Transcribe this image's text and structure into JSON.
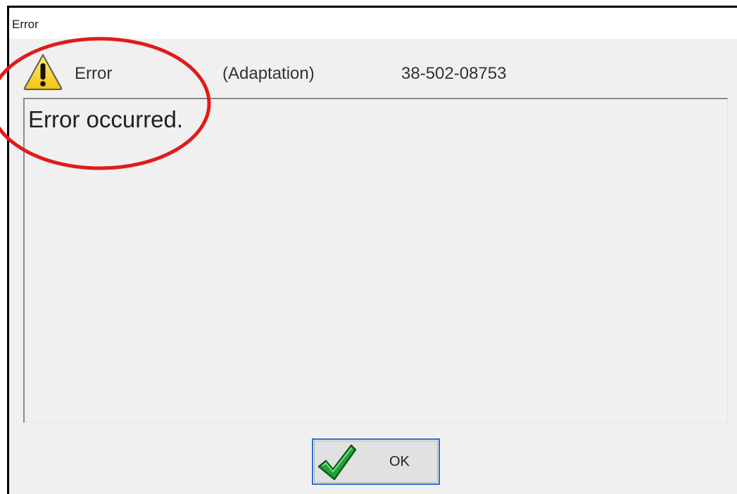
{
  "window": {
    "title": "Error"
  },
  "header": {
    "type": "Error",
    "category": "(Adaptation)",
    "code": "38-502-08753",
    "icon": "warning-icon"
  },
  "message": {
    "text": "Error occurred."
  },
  "buttons": {
    "ok": {
      "label": "OK",
      "icon": "checkmark-icon"
    }
  },
  "colors": {
    "annotation": "#e01b1b",
    "button_focus": "#2b6cc4",
    "warning_yellow": "#f7d21c",
    "check_green": "#1f9a2e"
  }
}
